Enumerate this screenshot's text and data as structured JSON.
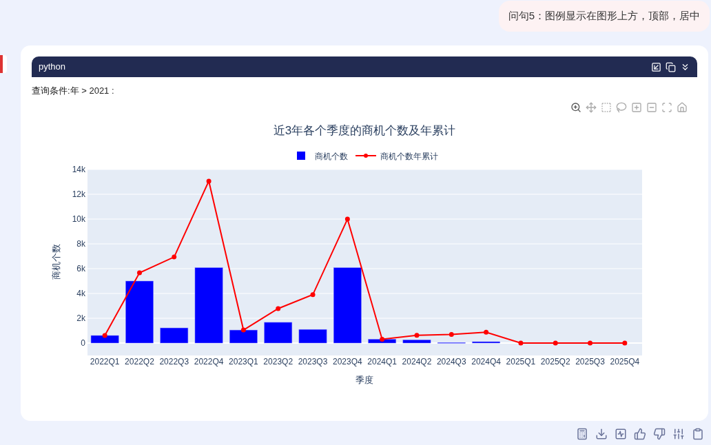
{
  "user_message": "问句5：图例显示在图形上方，顶部，居中",
  "code_block": {
    "language": "python"
  },
  "query_condition": "查询条件:年 > 2021 :",
  "chart": {
    "chart_data": {
      "type": "bar",
      "title": "近3年各个季度的商机个数及年累计",
      "xlabel": "季度",
      "ylabel": "商机个数",
      "categories": [
        "2022Q1",
        "2022Q2",
        "2022Q3",
        "2022Q4",
        "2023Q1",
        "2023Q2",
        "2023Q3",
        "2023Q4",
        "2024Q1",
        "2024Q2",
        "2024Q3",
        "2024Q4",
        "2025Q1",
        "2025Q2",
        "2025Q3",
        "2025Q4"
      ],
      "series": [
        {
          "name": "商机个数",
          "type": "bar",
          "color": "#0000ff",
          "values": [
            610,
            5000,
            1220,
            6080,
            1050,
            1670,
            1100,
            6080,
            310,
            260,
            40,
            110,
            0,
            0,
            0,
            0
          ]
        },
        {
          "name": "商机个数年累计",
          "type": "line",
          "marker": true,
          "color": "#ff0000",
          "values": [
            610,
            5660,
            6940,
            13060,
            1050,
            2780,
            3900,
            10000,
            310,
            630,
            700,
            870,
            0,
            0,
            0,
            0
          ]
        }
      ],
      "ylim": [
        -1000,
        14000
      ],
      "grid": true,
      "legend": true,
      "yticks": [
        {
          "value": 0,
          "label": "0"
        },
        {
          "value": 2000,
          "label": "2k"
        },
        {
          "value": 4000,
          "label": "4k"
        },
        {
          "value": 6000,
          "label": "6k"
        },
        {
          "value": 8000,
          "label": "8k"
        },
        {
          "value": 10000,
          "label": "10k"
        },
        {
          "value": 12000,
          "label": "12k"
        },
        {
          "value": 14000,
          "label": "14k"
        }
      ]
    }
  }
}
